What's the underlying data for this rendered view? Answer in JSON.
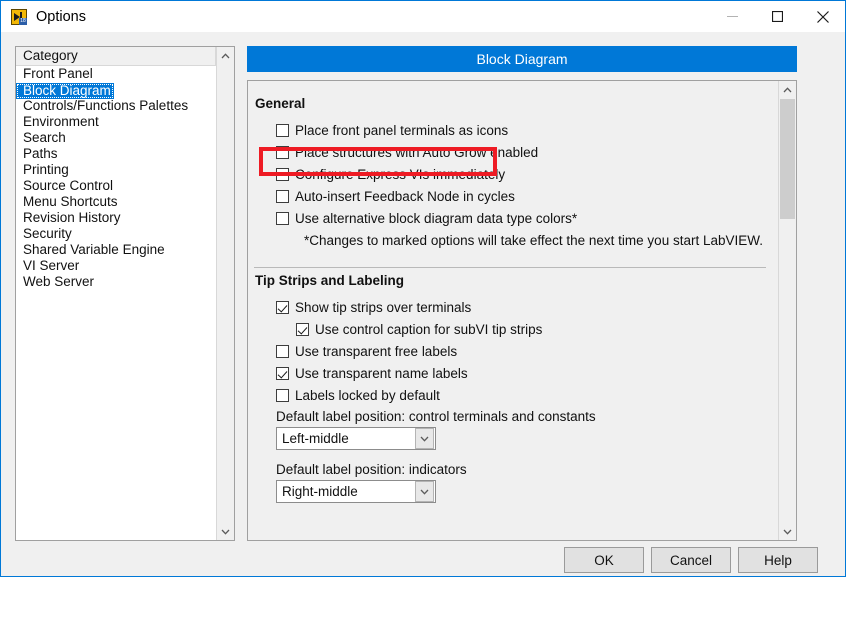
{
  "window": {
    "title": "Options",
    "icon": "labview-options-icon",
    "icon_badge": "18",
    "controls": {
      "minimize": "minimize-icon",
      "maximize": "maximize-icon",
      "close": "close-icon"
    }
  },
  "category": {
    "header": "Category",
    "items": [
      {
        "label": "Front Panel",
        "selected": false
      },
      {
        "label": "Block Diagram",
        "selected": true
      },
      {
        "label": "Controls/Functions Palettes",
        "selected": false
      },
      {
        "label": "Environment",
        "selected": false
      },
      {
        "label": "Search",
        "selected": false
      },
      {
        "label": "Paths",
        "selected": false
      },
      {
        "label": "Printing",
        "selected": false
      },
      {
        "label": "Source Control",
        "selected": false
      },
      {
        "label": "Menu Shortcuts",
        "selected": false
      },
      {
        "label": "Revision History",
        "selected": false
      },
      {
        "label": "Security",
        "selected": false
      },
      {
        "label": "Shared Variable Engine",
        "selected": false
      },
      {
        "label": "VI Server",
        "selected": false
      },
      {
        "label": "Web Server",
        "selected": false
      }
    ]
  },
  "pane": {
    "header": "Block Diagram",
    "general": {
      "title": "General",
      "options": [
        {
          "label": "Place front panel terminals as icons",
          "checked": false
        },
        {
          "label": "Place structures with Auto Grow enabled",
          "checked": false
        },
        {
          "label": "Configure Express VIs immediately",
          "checked": false
        },
        {
          "label": "Auto-insert Feedback Node in cycles",
          "checked": false
        },
        {
          "label": "Use alternative block diagram data type colors*",
          "checked": false
        }
      ],
      "note": "*Changes to marked options will take effect the next time you start LabVIEW."
    },
    "tip_strips": {
      "title": "Tip Strips and Labeling",
      "options": [
        {
          "label": "Show tip strips over terminals",
          "checked": true,
          "indented": false
        },
        {
          "label": "Use control caption for subVI tip strips",
          "checked": true,
          "indented": true
        },
        {
          "label": "Use transparent free labels",
          "checked": false,
          "indented": false
        },
        {
          "label": "Use transparent name labels",
          "checked": true,
          "indented": false
        },
        {
          "label": "Labels locked by default",
          "checked": false,
          "indented": false
        }
      ],
      "control_label_position": {
        "label": "Default label position: control terminals and constants",
        "value": "Left-middle"
      },
      "indicator_label_position": {
        "label": "Default label position: indicators",
        "value": "Right-middle"
      }
    }
  },
  "footer": {
    "ok": "OK",
    "cancel": "Cancel",
    "help": "Help"
  },
  "annotation": {
    "highlight_color": "#ee1b24",
    "highlight_target": "Place front panel terminals as icons"
  },
  "colors": {
    "accent": "#0078d7",
    "dialog_background": "#f0f0f0",
    "highlight": "#ee1b24"
  }
}
